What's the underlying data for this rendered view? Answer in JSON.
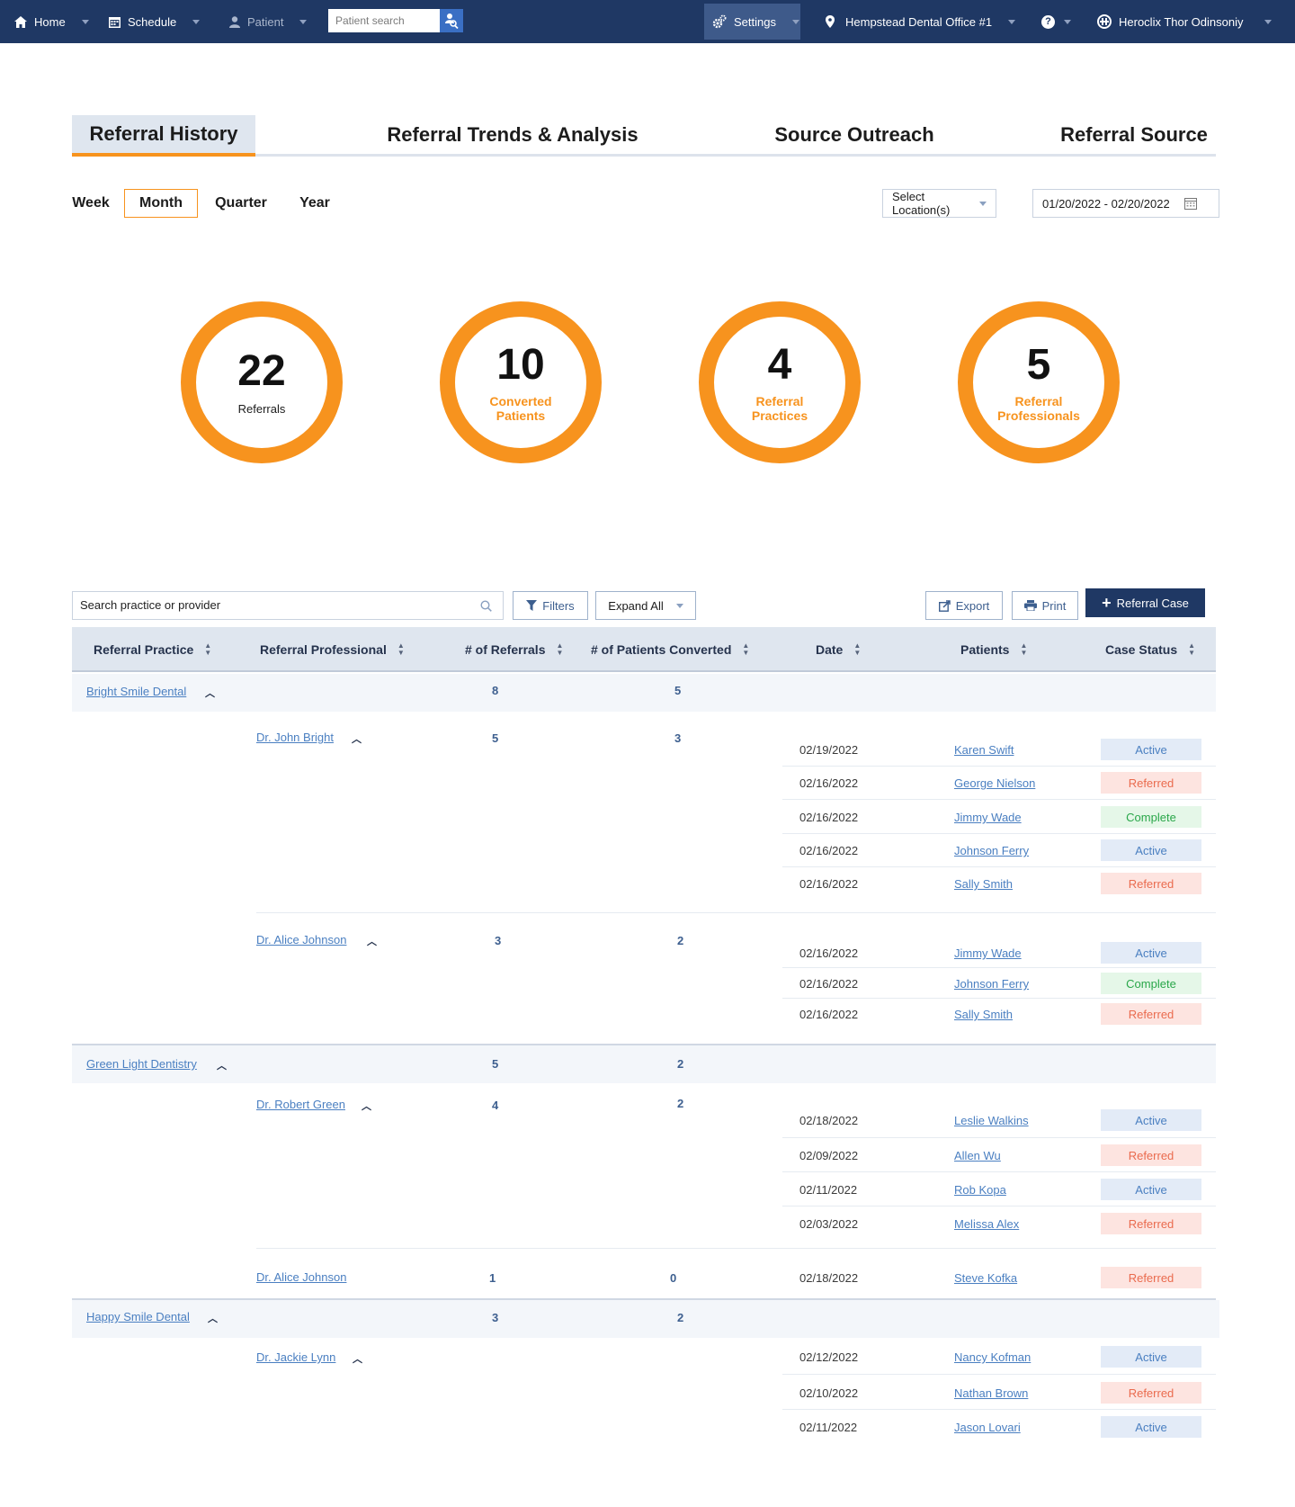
{
  "nav": {
    "home": "Home",
    "schedule": "Schedule",
    "patient": "Patient",
    "patient_search_placeholder": "Patient search",
    "settings": "Settings",
    "location": "Hempstead Dental Office #1",
    "help": "?",
    "user": "Heroclix Thor Odinsoniy"
  },
  "tabs": [
    "Referral History",
    "Referral Trends & Analysis",
    "Source Outreach",
    "Referral Source"
  ],
  "periods": [
    "Week",
    "Month",
    "Quarter",
    "Year"
  ],
  "location_select": "Select Location(s)",
  "date_range": "01/20/2022 - 02/20/2022",
  "stats": [
    {
      "value": "22",
      "label": "Referrals"
    },
    {
      "value": "10",
      "label1": "Converted",
      "label2": "Patients"
    },
    {
      "value": "4",
      "label1": "Referral",
      "label2": "Practices"
    },
    {
      "value": "5",
      "label1": "Referral",
      "label2": "Professionals"
    }
  ],
  "toolbar": {
    "search_value": "Search practice or provider",
    "filters": "Filters",
    "expand_all": "Expand All",
    "export": "Export",
    "print": "Print",
    "referral_case": "Referral Case"
  },
  "columns": [
    "Referral Practice",
    "Referral Professional",
    "# of Referrals",
    "# of Patients Converted",
    "Date",
    "Patients",
    "Case Status"
  ],
  "rows": {
    "p1": {
      "name": "Bright Smile Dental",
      "referrals": "8",
      "converted": "5"
    },
    "p1d1": {
      "name": "Dr. John Bright",
      "referrals": "5",
      "converted": "3"
    },
    "p1d1r": [
      {
        "date": "02/19/2022",
        "patient": "Karen Swift",
        "status": "Active"
      },
      {
        "date": "02/16/2022",
        "patient": "George Nielson",
        "status": "Referred"
      },
      {
        "date": "02/16/2022",
        "patient": "Jimmy Wade",
        "status": "Complete"
      },
      {
        "date": "02/16/2022",
        "patient": "Johnson Ferry",
        "status": "Active"
      },
      {
        "date": "02/16/2022",
        "patient": "Sally Smith",
        "status": "Referred"
      }
    ],
    "p1d2": {
      "name": "Dr. Alice Johnson",
      "referrals": "3",
      "converted": "2"
    },
    "p1d2r": [
      {
        "date": "02/16/2022",
        "patient": "Jimmy Wade",
        "status": "Active"
      },
      {
        "date": "02/16/2022",
        "patient": "Johnson Ferry",
        "status": "Complete"
      },
      {
        "date": "02/16/2022",
        "patient": "Sally Smith",
        "status": "Referred"
      }
    ],
    "p2": {
      "name": "Green Light Dentistry",
      "referrals": "5",
      "converted": "2"
    },
    "p2d1": {
      "name": "Dr. Robert Green",
      "referrals": "4",
      "converted": "2"
    },
    "p2d1r": [
      {
        "date": "02/18/2022",
        "patient": "Leslie Walkins",
        "status": "Active"
      },
      {
        "date": "02/09/2022",
        "patient": "Allen Wu",
        "status": "Referred"
      },
      {
        "date": "02/11/2022",
        "patient": "Rob Kopa",
        "status": "Active"
      },
      {
        "date": "02/03/2022",
        "patient": "Melissa Alex",
        "status": "Referred"
      }
    ],
    "p2d2": {
      "name": "Dr. Alice Johnson",
      "referrals": "1",
      "converted": "0",
      "date": "02/18/2022",
      "patient": "Steve Kofka",
      "status": "Referred"
    },
    "p3": {
      "name": "Happy Smile Dental",
      "referrals": "3",
      "converted": "2"
    },
    "p3d1": {
      "name": "Dr. Jackie Lynn"
    },
    "p3d1r": [
      {
        "date": "02/12/2022",
        "patient": "Nancy Kofman",
        "status": "Active"
      },
      {
        "date": "02/10/2022",
        "patient": "Nathan Brown",
        "status": "Referred"
      },
      {
        "date": "02/11/2022",
        "patient": "Jason Lovari",
        "status": "Active"
      }
    ]
  },
  "colors": {
    "nav": "#1f3864",
    "accent": "#f7931e",
    "link": "#4a7fc1"
  }
}
